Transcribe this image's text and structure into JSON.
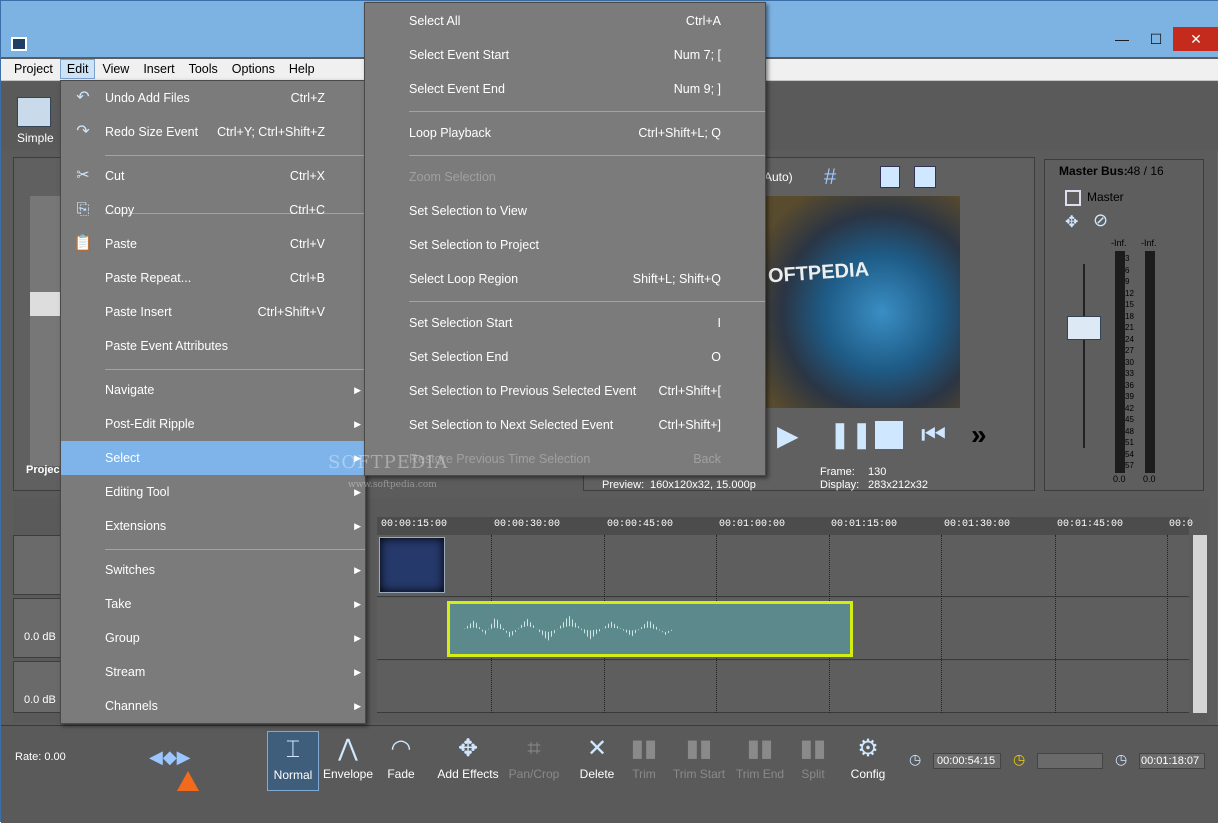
{
  "window": {
    "minimize": "—",
    "maximize": "☐",
    "close": "✕"
  },
  "menubar": [
    "Project",
    "Edit",
    "View",
    "Insert",
    "Tools",
    "Options",
    "Help"
  ],
  "toolbar": {
    "simple_label": "Simple"
  },
  "project_panel": {
    "label": "Projec"
  },
  "preview": {
    "quality": "Auto)",
    "image_text": "OFTPEDIA",
    "frame_label": "Frame:",
    "frame_value": "130",
    "display_label": "Display:",
    "display_value": "283x212x32",
    "preview_label": "Preview:",
    "preview_value": "160x120x32, 15.000p"
  },
  "master_bus": {
    "title": "Master Bus:",
    "value": "48 / 16",
    "master_label": "Master",
    "inf_left": "-Inf.",
    "inf_right": "-Inf.",
    "scale": [
      "3",
      "6",
      "9",
      "12",
      "15",
      "18",
      "21",
      "24",
      "27",
      "30",
      "33",
      "36",
      "39",
      "42",
      "45",
      "48",
      "51",
      "54",
      "57"
    ],
    "bottom_left": "0.0",
    "bottom_right": "0.0"
  },
  "ruler": [
    "00:00:15:00",
    "00:00:30:00",
    "00:00:45:00",
    "00:01:00:00",
    "00:01:15:00",
    "00:01:30:00",
    "00:01:45:00",
    "00:0"
  ],
  "tracks": {
    "audio1_db": "0.0 dB",
    "audio2_db": "0.0 dB"
  },
  "bottom": {
    "rate": "Rate: 0.00",
    "tools": [
      {
        "label": "Normal",
        "icon": "normal-edit-icon"
      },
      {
        "label": "Envelope",
        "icon": "envelope-icon"
      },
      {
        "label": "Fade",
        "icon": "fade-icon"
      },
      {
        "label": "Add Effects",
        "icon": "add-effects-icon"
      },
      {
        "label": "Pan/Crop",
        "icon": "pan-crop-icon"
      },
      {
        "label": "Delete",
        "icon": "delete-icon"
      },
      {
        "label": "Trim",
        "icon": "trim-icon"
      },
      {
        "label": "Trim Start",
        "icon": "trim-start-icon"
      },
      {
        "label": "Trim End",
        "icon": "trim-end-icon"
      },
      {
        "label": "Split",
        "icon": "split-icon"
      },
      {
        "label": "Config",
        "icon": "gear-icon"
      }
    ],
    "time_cursor": "00:00:54:15",
    "time_end": "00:01:18:07"
  },
  "edit_menu": [
    {
      "label": "Undo Add Files",
      "shortcut": "Ctrl+Z",
      "icon": "undo-icon"
    },
    {
      "label": "Redo Size Event",
      "shortcut": "Ctrl+Y; Ctrl+Shift+Z",
      "icon": "redo-icon"
    },
    {
      "label": "Cut",
      "shortcut": "Ctrl+X",
      "icon": "scissors-icon"
    },
    {
      "label": "Copy",
      "shortcut": "Ctrl+C",
      "icon": "copy-icon"
    },
    {
      "label": "Paste",
      "shortcut": "Ctrl+V",
      "icon": "paste-icon"
    },
    {
      "label": "Paste Repeat...",
      "shortcut": "Ctrl+B"
    },
    {
      "label": "Paste Insert",
      "shortcut": "Ctrl+Shift+V"
    },
    {
      "label": "Paste Event Attributes",
      "shortcut": ""
    },
    {
      "label": "Navigate"
    },
    {
      "label": "Post-Edit Ripple"
    },
    {
      "label": "Select"
    },
    {
      "label": "Editing Tool"
    },
    {
      "label": "Extensions"
    },
    {
      "label": "Switches"
    },
    {
      "label": "Take"
    },
    {
      "label": "Group"
    },
    {
      "label": "Stream"
    },
    {
      "label": "Channels"
    }
  ],
  "select_menu": [
    {
      "label": "Select All",
      "shortcut": "Ctrl+A"
    },
    {
      "label": "Select Event Start",
      "shortcut": "Num 7; ["
    },
    {
      "label": "Select Event End",
      "shortcut": "Num 9; ]"
    },
    {
      "label": "Loop Playback",
      "shortcut": "Ctrl+Shift+L; Q"
    },
    {
      "label": "Zoom Selection",
      "shortcut": ""
    },
    {
      "label": "Set Selection to View",
      "shortcut": ""
    },
    {
      "label": "Set Selection to Project",
      "shortcut": ""
    },
    {
      "label": "Select Loop Region",
      "shortcut": "Shift+L; Shift+Q"
    },
    {
      "label": "Set Selection Start",
      "shortcut": "I"
    },
    {
      "label": "Set Selection End",
      "shortcut": "O"
    },
    {
      "label": "Set Selection to Previous Selected Event",
      "shortcut": "Ctrl+Shift+["
    },
    {
      "label": "Set Selection to Next Selected Event",
      "shortcut": "Ctrl+Shift+]"
    },
    {
      "label": "Restore Previous Time Selection",
      "shortcut": "Back"
    }
  ],
  "watermark": {
    "main": "SOFTPEDIA",
    "url": "www.softpedia.com"
  }
}
